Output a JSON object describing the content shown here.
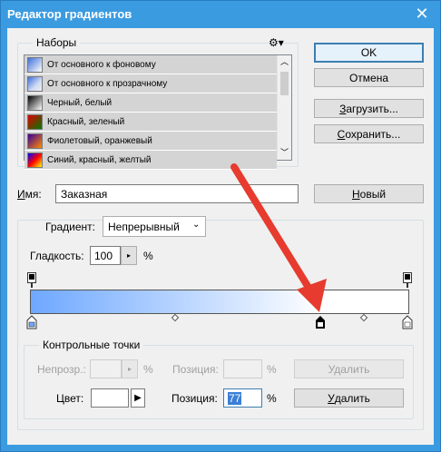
{
  "window": {
    "title": "Редактор градиентов",
    "close": "✕"
  },
  "presets": {
    "label": "Наборы",
    "items": [
      {
        "label": "От основного к фоновому",
        "swatch": "linear-gradient(135deg,#3f6fd8 0%,#ffffff 100%)"
      },
      {
        "label": "От основного к прозрачному",
        "swatch": "linear-gradient(135deg,#3f6fd8 0%,#cfdaf5 60%,#eeeeee 100%)"
      },
      {
        "label": "Черный, белый",
        "swatch": "linear-gradient(135deg,#000000 0%,#ffffff 100%)"
      },
      {
        "label": "Красный, зеленый",
        "swatch": "linear-gradient(135deg,#e00000 0%,#007a00 100%)"
      },
      {
        "label": "Фиолетовый, оранжевый",
        "swatch": "linear-gradient(135deg,#3a0099 0%,#ff8a00 100%)"
      },
      {
        "label": "Синий, красный, желтый",
        "swatch": "linear-gradient(135deg,#0000ff 0%,#ff0000 50%,#ffff00 100%)"
      }
    ]
  },
  "buttons": {
    "ok": "OK",
    "cancel": "Отмена",
    "load_u": "З",
    "load_rest": "агрузить...",
    "save_u": "С",
    "save_rest": "охранить...",
    "new_u": "Н",
    "new_rest": "овый"
  },
  "name": {
    "label_u": "И",
    "label_rest": "мя:",
    "value": "Заказная"
  },
  "gradient": {
    "type_label": "Градиент:",
    "type_value": "Непрерывный",
    "smoothness_label": "Гладкость:",
    "smoothness_value": "100",
    "smoothness_unit": "%",
    "start_color": "#6ea8ff",
    "end_color": "#ffffff"
  },
  "stops": {
    "group_label": "Контрольные точки",
    "opacity_label": "Непрозр.:",
    "opacity_unit": "%",
    "opacity_position_label": "Позиция:",
    "opacity_position_unit": "%",
    "delete_disabled": "Удалить",
    "color_label": "Цвет:",
    "color_value": "#ffffff",
    "position_label": "Позиция:",
    "position_value": "77",
    "position_unit": "%",
    "delete_u": "У",
    "delete_rest": "далить"
  },
  "annotation": {
    "color": "#e63b2e"
  }
}
